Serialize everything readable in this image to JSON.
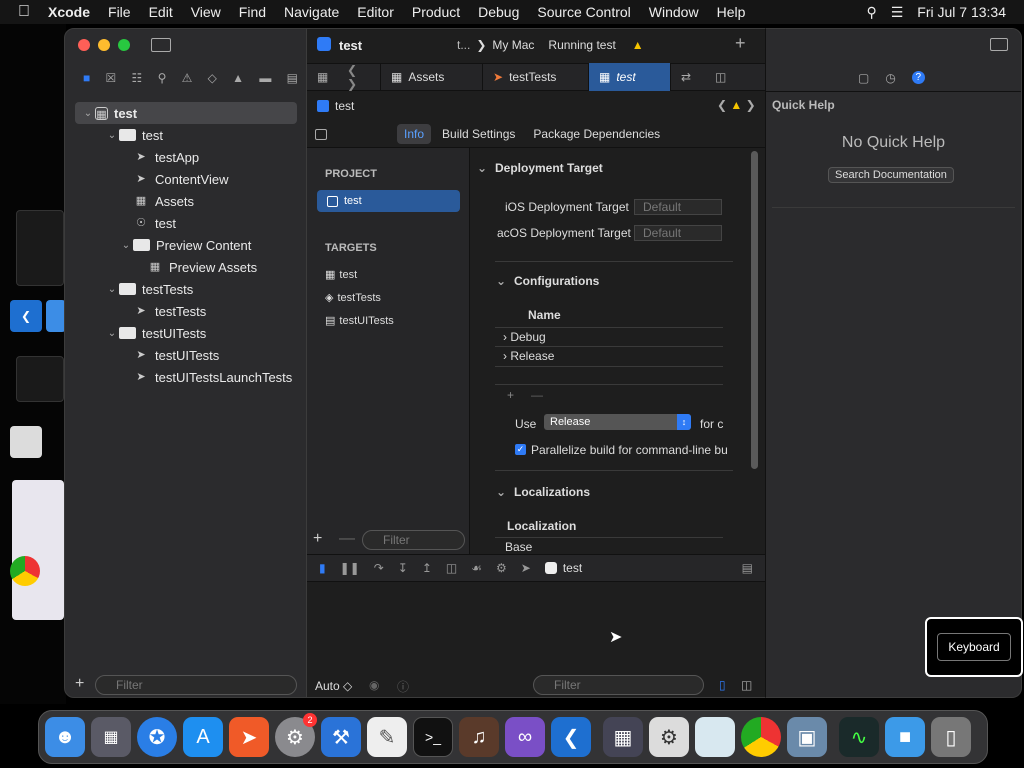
{
  "menubar": {
    "app": "Xcode",
    "items": [
      "File",
      "Edit",
      "View",
      "Find",
      "Navigate",
      "Editor",
      "Product",
      "Debug",
      "Source Control",
      "Window",
      "Help"
    ],
    "clock": "Fri Jul 7  13:34"
  },
  "toolbar": {
    "project": "test",
    "scheme": "t...",
    "destination": "My Mac",
    "status": "Running test"
  },
  "editor_tabs": [
    "Assets",
    "testTests",
    "test"
  ],
  "jump_bar": "test",
  "segments": [
    "Info",
    "Build Settings",
    "Package Dependencies"
  ],
  "navigator": {
    "rows": [
      {
        "label": "test",
        "depth": 0,
        "kind": "project"
      },
      {
        "label": "test",
        "depth": 1,
        "kind": "folder"
      },
      {
        "label": "testApp",
        "depth": 2,
        "kind": "swift"
      },
      {
        "label": "ContentView",
        "depth": 2,
        "kind": "swift"
      },
      {
        "label": "Assets",
        "depth": 2,
        "kind": "assets"
      },
      {
        "label": "test",
        "depth": 2,
        "kind": "entitlements"
      },
      {
        "label": "Preview Content",
        "depth": 2,
        "kind": "folder"
      },
      {
        "label": "Preview Assets",
        "depth": 3,
        "kind": "assets"
      },
      {
        "label": "testTests",
        "depth": 1,
        "kind": "folder"
      },
      {
        "label": "testTests",
        "depth": 2,
        "kind": "swift"
      },
      {
        "label": "testUITests",
        "depth": 1,
        "kind": "folder"
      },
      {
        "label": "testUITests",
        "depth": 2,
        "kind": "swift"
      },
      {
        "label": "testUITestsLaunchTests",
        "depth": 2,
        "kind": "swift"
      }
    ],
    "filter_placeholder": "Filter"
  },
  "project_list": {
    "project_header": "PROJECT",
    "project": "test",
    "targets_header": "TARGETS",
    "targets": [
      "test",
      "testTests",
      "testUITests"
    ],
    "filter_placeholder": "Filter"
  },
  "settings": {
    "deployment": {
      "header": "Deployment Target",
      "ios_label": "iOS Deployment Target",
      "ios_value": "Default",
      "macos_label": "acOS Deployment Target",
      "macos_value": "Default"
    },
    "configurations": {
      "header": "Configurations",
      "col_name": "Name",
      "rows": [
        "Debug",
        "Release"
      ],
      "use_label": "Use",
      "use_value": "Release",
      "for_label": "for c",
      "parallelize": "Parallelize build for command-line bu"
    },
    "localizations": {
      "header": "Localizations",
      "col": "Localization",
      "rows": [
        "Base"
      ]
    }
  },
  "debug": {
    "process": "test",
    "auto": "Auto ◇",
    "filter_placeholder": "Filter"
  },
  "inspector": {
    "title": "Quick Help",
    "empty": "No Quick Help",
    "search_button": "Search Documentation"
  },
  "keyboard_popup": "Keyboard",
  "dock_badge": "2",
  "colors": {
    "accent": "#2f7bf6",
    "selection": "#2a5a9a"
  }
}
